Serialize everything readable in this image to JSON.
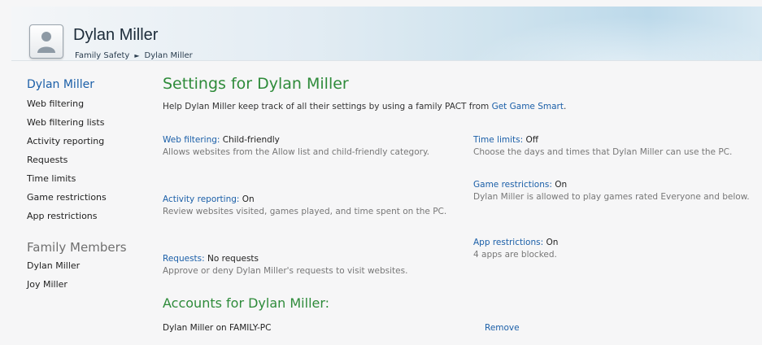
{
  "header": {
    "title": "Dylan Miller",
    "breadcrumb": [
      "Family Safety",
      "Dylan Miller"
    ]
  },
  "sidebar": {
    "user": "Dylan Miller",
    "items": [
      "Web filtering",
      "Web filtering lists",
      "Activity reporting",
      "Requests",
      "Time limits",
      "Game restrictions",
      "App restrictions"
    ],
    "family_heading": "Family Members",
    "members": [
      "Dylan Miller",
      "Joy Miller"
    ]
  },
  "main": {
    "title": "Settings for Dylan Miller",
    "intro_text": "Help Dylan Miller keep track of all their settings by using a family PACT from",
    "intro_link": "Get Game Smart",
    "intro_end": ".",
    "settings": {
      "web_filtering": {
        "label": "Web filtering:",
        "value": "Child-friendly",
        "desc": "Allows websites from the Allow list and child-friendly category."
      },
      "activity_reporting": {
        "label": "Activity reporting:",
        "value": "On",
        "desc": "Review websites visited, games played, and time spent on the PC."
      },
      "requests": {
        "label": "Requests:",
        "value": "No requests",
        "desc": "Approve or deny Dylan Miller's requests to visit websites."
      },
      "time_limits": {
        "label": "Time limits:",
        "value": "Off",
        "desc": "Choose the days and times that Dylan Miller can use the PC."
      },
      "game_restrictions": {
        "label": "Game restrictions:",
        "value": "On",
        "desc": "Dylan Miller is allowed to play games rated Everyone and below."
      },
      "app_restrictions": {
        "label": "App restrictions:",
        "value": "On",
        "desc": "4 apps are blocked."
      }
    },
    "accounts_title": "Accounts for Dylan Miller:",
    "account_name": "Dylan Miller on FAMILY-PC",
    "remove_label": "Remove"
  },
  "colors": {
    "link": "#1b5fa8",
    "heading_green": "#2e8b3a"
  }
}
